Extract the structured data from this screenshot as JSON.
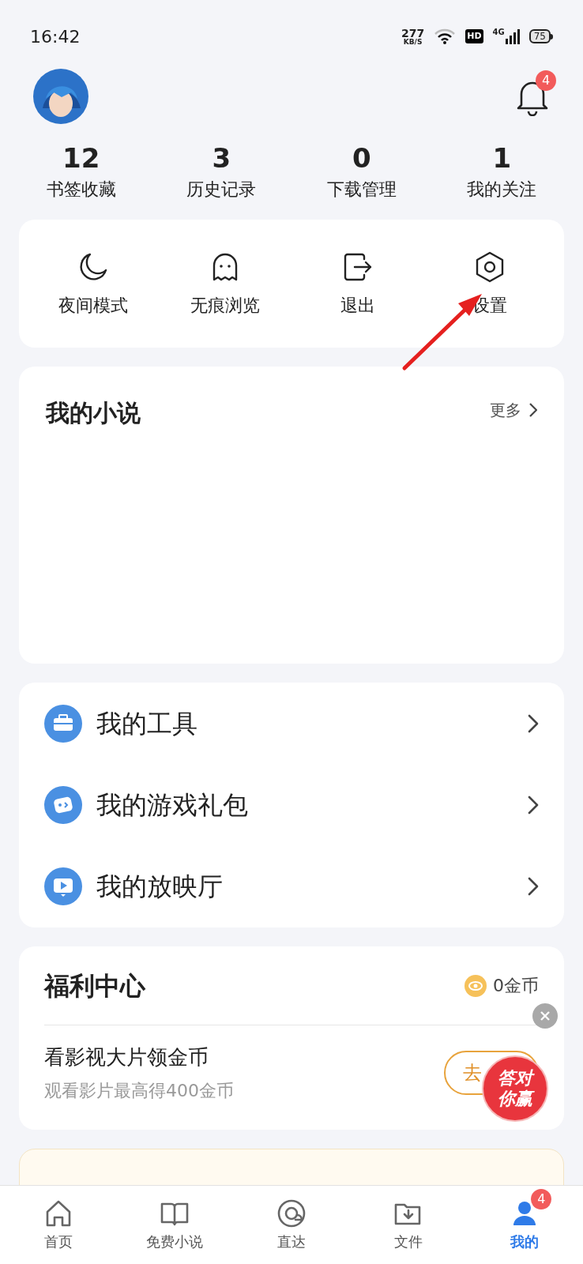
{
  "status_bar": {
    "time": "16:42",
    "speed": "277",
    "speed_unit": "KB/S",
    "hd": "HD",
    "network": "4G",
    "battery": "75"
  },
  "header": {
    "notification_count": "4"
  },
  "stats": [
    {
      "value": "12",
      "label": "书签收藏"
    },
    {
      "value": "3",
      "label": "历史记录"
    },
    {
      "value": "0",
      "label": "下载管理"
    },
    {
      "value": "1",
      "label": "我的关注"
    }
  ],
  "quick_actions": [
    {
      "kind": "moon",
      "label": "夜间模式"
    },
    {
      "kind": "ghost",
      "label": "无痕浏览"
    },
    {
      "kind": "exit",
      "label": "退出"
    },
    {
      "kind": "settings",
      "label": "设置"
    }
  ],
  "my_novels": {
    "title": "我的小说",
    "more": "更多"
  },
  "menu": [
    {
      "kind": "tools",
      "label": "我的工具"
    },
    {
      "kind": "game",
      "label": "我的游戏礼包"
    },
    {
      "kind": "video",
      "label": "我的放映厅"
    }
  ],
  "welfare": {
    "title": "福利中心",
    "coins": "0金币",
    "task_title": "看影视大片领金币",
    "task_subtitle": "观看影片最高得400金币",
    "button": "去",
    "sticker": "答对你赢"
  },
  "tab_bar": [
    {
      "kind": "home",
      "label": "首页",
      "selected": false
    },
    {
      "kind": "book",
      "label": "免费小说",
      "selected": false
    },
    {
      "kind": "direct",
      "label": "直达",
      "selected": false
    },
    {
      "kind": "file",
      "label": "文件",
      "selected": false
    },
    {
      "kind": "me",
      "label": "我的",
      "selected": true,
      "badge": "4"
    }
  ]
}
